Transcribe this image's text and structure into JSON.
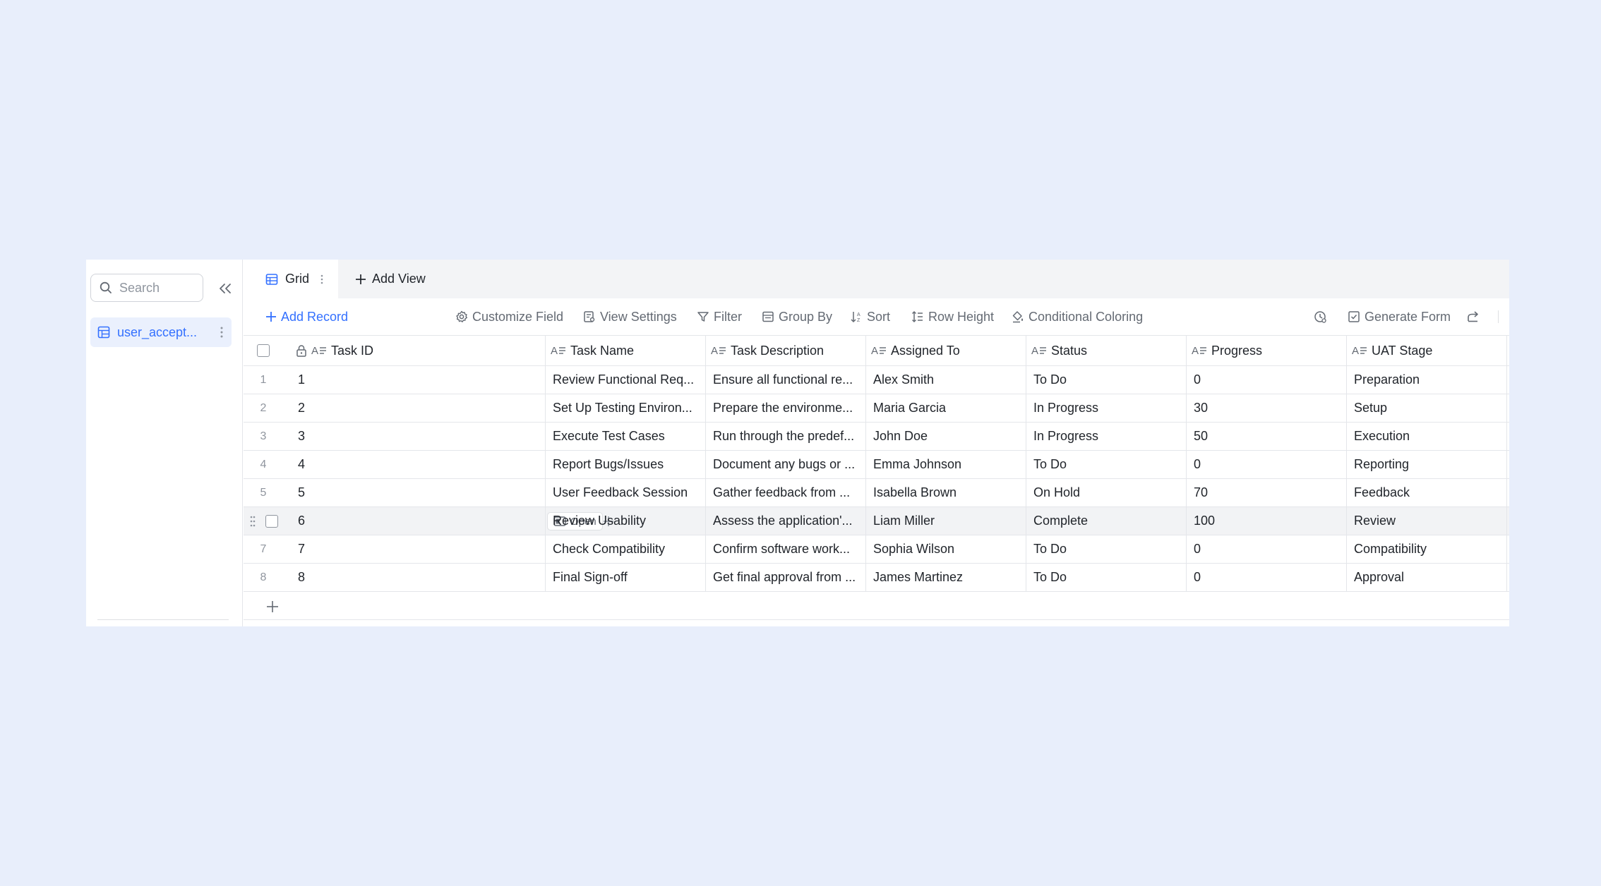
{
  "sidebar": {
    "search_placeholder": "Search",
    "table_name": "user_accept..."
  },
  "tabs": {
    "grid_label": "Grid",
    "add_view_label": "Add View"
  },
  "toolbar": {
    "add_record": "Add Record",
    "customize_field": "Customize Field",
    "view_settings": "View Settings",
    "filter": "Filter",
    "group_by": "Group By",
    "sort": "Sort",
    "row_height": "Row Height",
    "conditional_coloring": "Conditional Coloring",
    "generate_form": "Generate Form"
  },
  "columns": [
    "Task ID",
    "Task Name",
    "Task Description",
    "Assigned To",
    "Status",
    "Progress",
    "UAT Stage"
  ],
  "open_label": "Open",
  "rows": [
    {
      "num": "1",
      "id": "1",
      "name": "Review Functional Req...",
      "desc": "Ensure all functional re...",
      "assigned": "Alex Smith",
      "status": "To Do",
      "progress": "0",
      "stage": "Preparation"
    },
    {
      "num": "2",
      "id": "2",
      "name": "Set Up Testing Environ...",
      "desc": "Prepare the environme...",
      "assigned": "Maria Garcia",
      "status": "In Progress",
      "progress": "30",
      "stage": "Setup"
    },
    {
      "num": "3",
      "id": "3",
      "name": "Execute Test Cases",
      "desc": "Run through the predef...",
      "assigned": "John Doe",
      "status": "In Progress",
      "progress": "50",
      "stage": "Execution"
    },
    {
      "num": "4",
      "id": "4",
      "name": "Report Bugs/Issues",
      "desc": "Document any bugs or ...",
      "assigned": "Emma Johnson",
      "status": "To Do",
      "progress": "0",
      "stage": "Reporting"
    },
    {
      "num": "5",
      "id": "5",
      "name": "User Feedback Session",
      "desc": "Gather feedback from ...",
      "assigned": "Isabella Brown",
      "status": "On Hold",
      "progress": "70",
      "stage": "Feedback"
    },
    {
      "num": "6",
      "id": "6",
      "name": "Review Usability",
      "desc": "Assess the application'...",
      "assigned": "Liam Miller",
      "status": "Complete",
      "progress": "100",
      "stage": "Review"
    },
    {
      "num": "7",
      "id": "7",
      "name": "Check Compatibility",
      "desc": "Confirm software work...",
      "assigned": "Sophia Wilson",
      "status": "To Do",
      "progress": "0",
      "stage": "Compatibility"
    },
    {
      "num": "8",
      "id": "8",
      "name": "Final Sign-off",
      "desc": "Get final approval from ...",
      "assigned": "James Martinez",
      "status": "To Do",
      "progress": "0",
      "stage": "Approval"
    }
  ]
}
